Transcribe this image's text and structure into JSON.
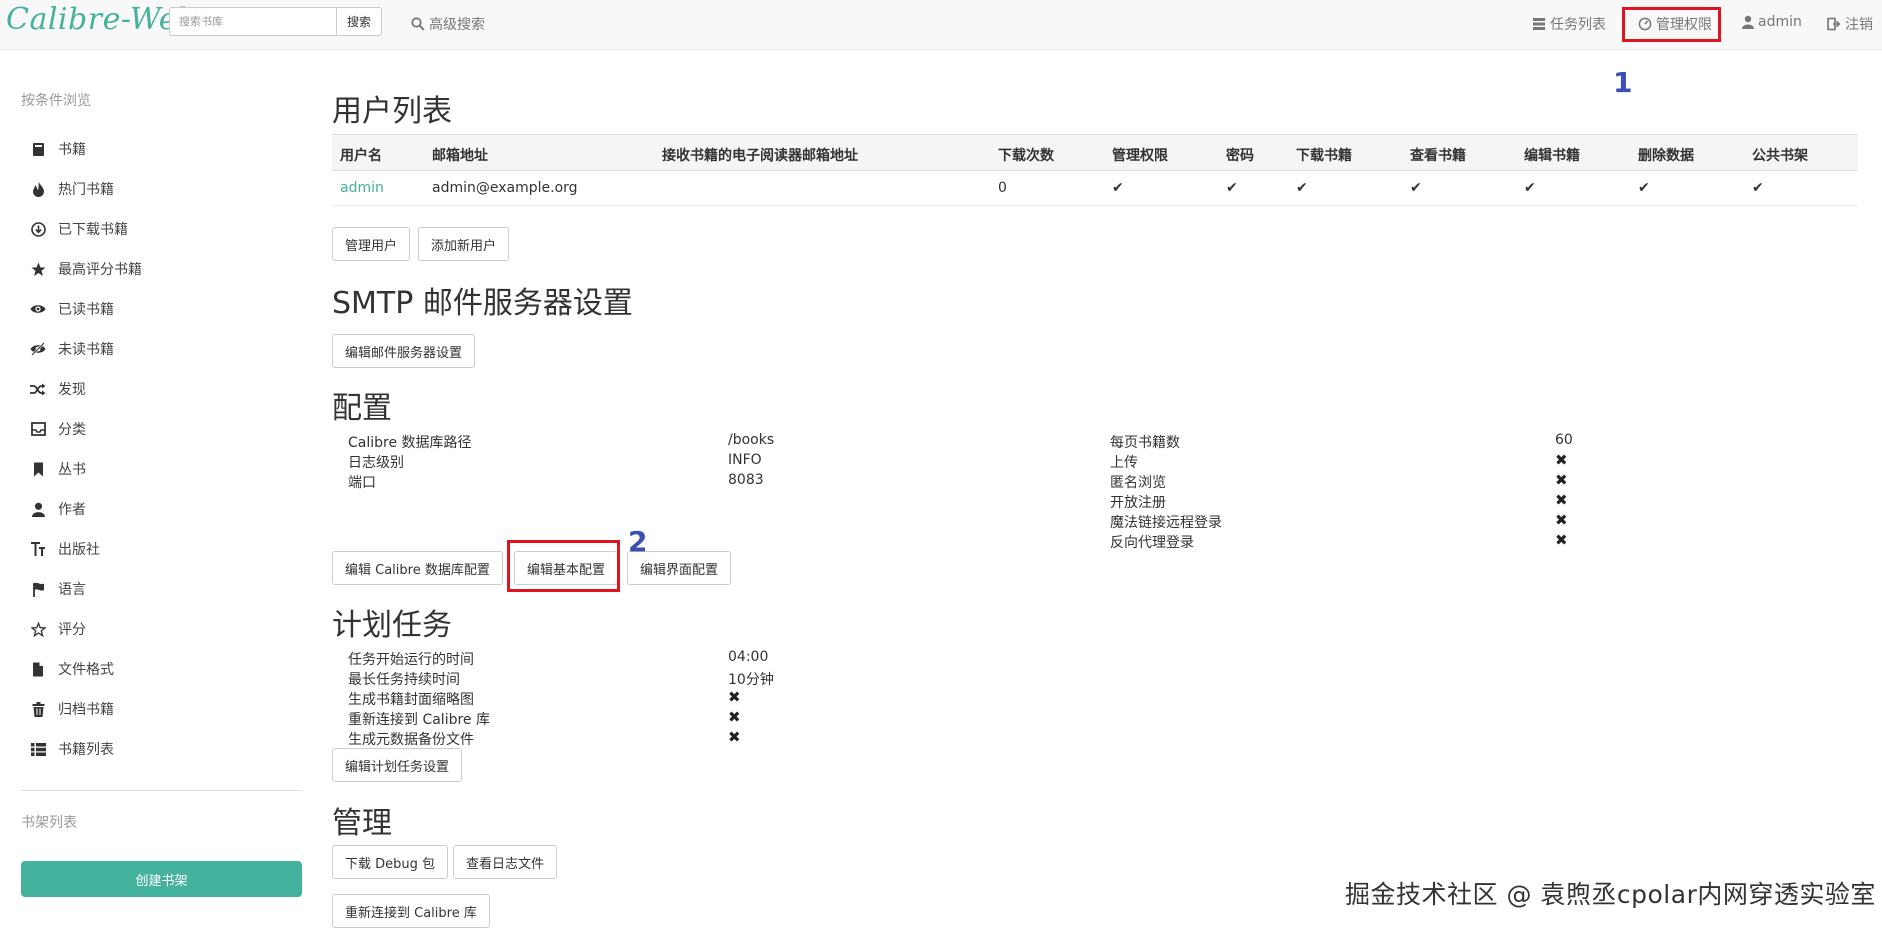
{
  "app": {
    "logo": "Calibre-Web"
  },
  "colors": {
    "accent": "#45b29d",
    "highlight": "#e0141e",
    "annotation": "#3b4fb5"
  },
  "navbar": {
    "search_placeholder": "搜索书库",
    "search_button": "搜索",
    "advanced_search": "高级搜索",
    "tasks": "任务列表",
    "admin": "管理权限",
    "user": "admin",
    "logout": "注销"
  },
  "sidebar": {
    "browse_heading": "按条件浏览",
    "items": [
      {
        "label": "书籍",
        "icon": "book-icon"
      },
      {
        "label": "热门书籍",
        "icon": "fire-icon"
      },
      {
        "label": "已下载书籍",
        "icon": "download-circle-icon"
      },
      {
        "label": "最高评分书籍",
        "icon": "star-icon"
      },
      {
        "label": "已读书籍",
        "icon": "eye-icon"
      },
      {
        "label": "未读书籍",
        "icon": "eye-off-icon"
      },
      {
        "label": "发现",
        "icon": "shuffle-icon"
      },
      {
        "label": "分类",
        "icon": "inbox-icon"
      },
      {
        "label": "丛书",
        "icon": "bookmark-icon"
      },
      {
        "label": "作者",
        "icon": "user-icon"
      },
      {
        "label": "出版社",
        "icon": "text-size-icon"
      },
      {
        "label": "语言",
        "icon": "flag-icon"
      },
      {
        "label": "评分",
        "icon": "star-outline-icon"
      },
      {
        "label": "文件格式",
        "icon": "file-icon"
      },
      {
        "label": "归档书籍",
        "icon": "trash-icon"
      },
      {
        "label": "书籍列表",
        "icon": "list-icon"
      }
    ],
    "shelf_heading": "书架列表",
    "create_shelf": "创建书架"
  },
  "users": {
    "title": "用户列表",
    "columns": [
      "用户名",
      "邮箱地址",
      "接收书籍的电子阅读器邮箱地址",
      "下载次数",
      "管理权限",
      "密码",
      "下载书籍",
      "查看书籍",
      "编辑书籍",
      "删除数据",
      "公共书架"
    ],
    "rows": [
      {
        "username": "admin",
        "email": "admin@example.org",
        "kindle": "",
        "downloads": "0",
        "admin": "✔",
        "password": "✔",
        "download": "✔",
        "view": "✔",
        "edit": "✔",
        "delete": "✔",
        "shelf": "✔"
      }
    ],
    "manage_button": "管理用户",
    "add_button": "添加新用户"
  },
  "smtp": {
    "title": "SMTP 邮件服务器设置",
    "edit_button": "编辑邮件服务器设置"
  },
  "config": {
    "title": "配置",
    "left": [
      {
        "label": "Calibre 数据库路径",
        "value": "/books"
      },
      {
        "label": "日志级别",
        "value": "INFO"
      },
      {
        "label": "端口",
        "value": "8083"
      }
    ],
    "right": [
      {
        "label": "每页书籍数",
        "value": "60"
      },
      {
        "label": "上传",
        "value": "✖"
      },
      {
        "label": "匿名浏览",
        "value": "✖"
      },
      {
        "label": "开放注册",
        "value": "✖"
      },
      {
        "label": "魔法链接远程登录",
        "value": "✖"
      },
      {
        "label": "反向代理登录",
        "value": "✖"
      }
    ],
    "btn_db": "编辑 Calibre 数据库配置",
    "btn_basic": "编辑基本配置",
    "btn_ui": "编辑界面配置"
  },
  "schedule": {
    "title": "计划任务",
    "items": [
      {
        "label": "任务开始运行的时间",
        "value": "04:00"
      },
      {
        "label": "最长任务持续时间",
        "value": "10分钟"
      },
      {
        "label": "生成书籍封面缩略图",
        "value": "✖"
      },
      {
        "label": "重新连接到 Calibre 库",
        "value": "✖"
      },
      {
        "label": "生成元数据备份文件",
        "value": "✖"
      }
    ],
    "edit_button": "编辑计划任务设置"
  },
  "admin_section": {
    "title": "管理",
    "debug_button": "下载 Debug 包",
    "log_button": "查看日志文件",
    "reconnect_button": "重新连接到 Calibre 库"
  },
  "annotations": {
    "one": "1",
    "two": "2"
  },
  "watermark": "掘金技术社区 @ 袁煦丞cpolar内网穿透实验室"
}
